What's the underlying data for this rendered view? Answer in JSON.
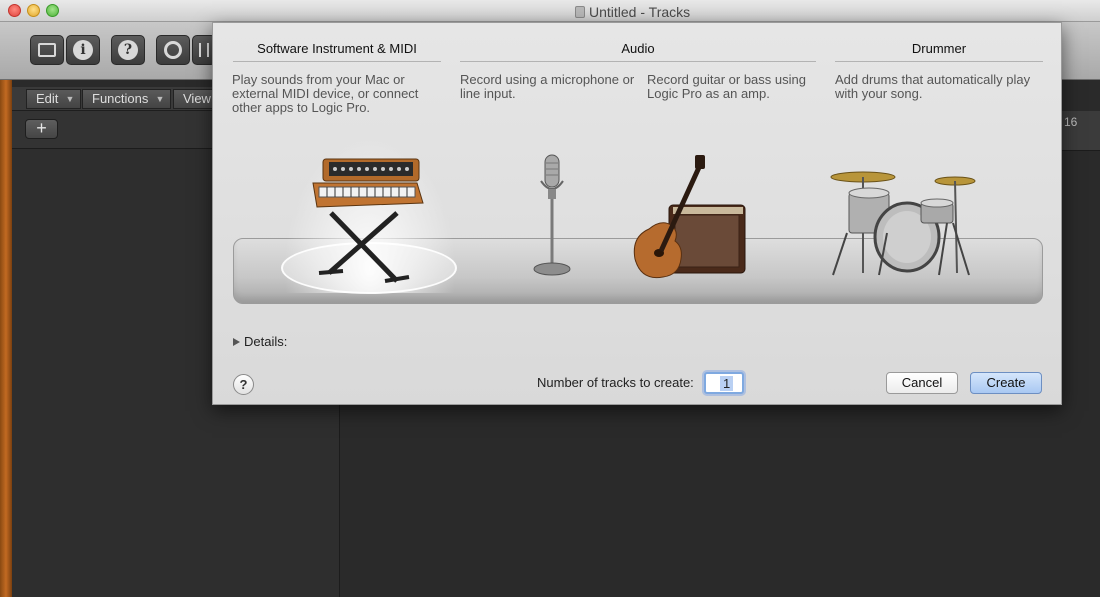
{
  "window": {
    "title": "Untitled - Tracks"
  },
  "toolbar": {
    "buttons": [
      "library-button",
      "inspector-button",
      "help-button",
      "smart-controls-button"
    ]
  },
  "track_area": {
    "menus": [
      {
        "label": "Edit"
      },
      {
        "label": "Functions"
      },
      {
        "label": "View"
      }
    ],
    "add_label": "+",
    "ruler_number": "16"
  },
  "dialog": {
    "columns": [
      {
        "title": "Software Instrument & MIDI",
        "description": "Play sounds from your Mac or external MIDI device, or connect other apps to Logic Pro."
      },
      {
        "title": "Audio",
        "descriptions": [
          "Record using a microphone or line input.",
          "Record guitar or bass using Logic Pro as an amp."
        ]
      },
      {
        "title": "Drummer",
        "description": "Add drums that automatically play with your song."
      }
    ],
    "selected": "Software Instrument & MIDI",
    "details_label": "Details:",
    "help_label": "?",
    "count_label": "Number of tracks to create:",
    "count_value": "1",
    "cancel_label": "Cancel",
    "create_label": "Create"
  },
  "colors": {
    "dialog_bg": "#dcdcdc",
    "create_button": "#a9c8f2",
    "background": "#2a2a2a"
  }
}
